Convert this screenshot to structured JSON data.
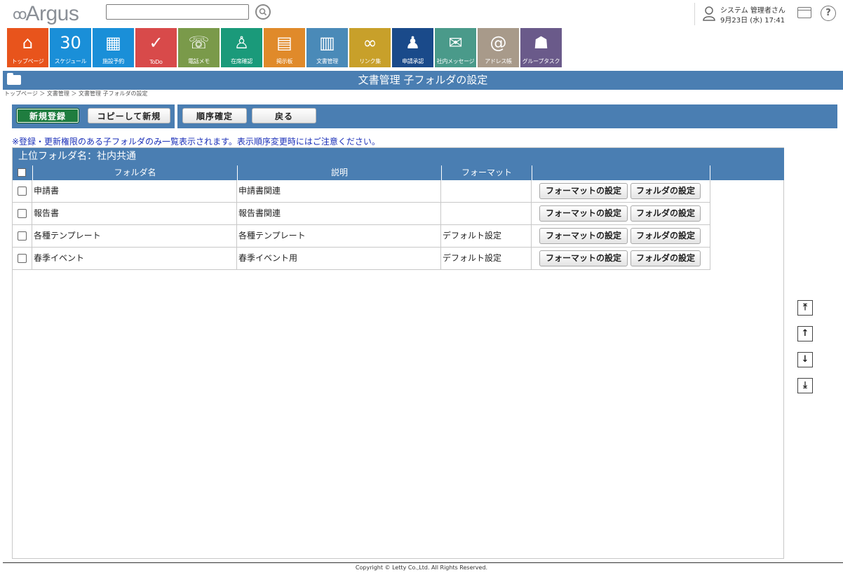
{
  "header": {
    "logo_text": "Argus",
    "search_placeholder": "",
    "user_name": "システム 管理者さん",
    "datetime": "9月23日 (水) 17:41"
  },
  "apps": [
    {
      "label": "トップページ",
      "icon": "house-icon",
      "color": "#e8541c",
      "glyph": "⌂"
    },
    {
      "label": "スケジュール",
      "icon": "calendar-icon",
      "color": "#1a8fd8",
      "glyph": "30"
    },
    {
      "label": "施設予約",
      "icon": "facility-icon",
      "color": "#1a8fd8",
      "glyph": "▦"
    },
    {
      "label": "ToDo",
      "icon": "todo-icon",
      "color": "#d84a4a",
      "glyph": "✓"
    },
    {
      "label": "電話メモ",
      "icon": "phone-icon",
      "color": "#7a9a4a",
      "glyph": "☏"
    },
    {
      "label": "在席確認",
      "icon": "presence-icon",
      "color": "#1a9a7a",
      "glyph": "♙"
    },
    {
      "label": "掲示板",
      "icon": "board-icon",
      "color": "#e08a2a",
      "glyph": "▤"
    },
    {
      "label": "文書管理",
      "icon": "document-icon",
      "color": "#4a8ab8",
      "glyph": "▥"
    },
    {
      "label": "リンク集",
      "icon": "link-icon",
      "color": "#c8a02a",
      "glyph": "∞"
    },
    {
      "label": "申請承認",
      "icon": "stamp-icon",
      "color": "#1a4a8a",
      "glyph": "♟"
    },
    {
      "label": "社内メッセージ",
      "icon": "message-icon",
      "color": "#4a9a8a",
      "glyph": "✉"
    },
    {
      "label": "アドレス帳",
      "icon": "address-book-icon",
      "color": "#a89a8a",
      "glyph": "@"
    },
    {
      "label": "グループタスク",
      "icon": "group-task-icon",
      "color": "#6a5a8a",
      "glyph": "☗"
    }
  ],
  "page": {
    "title": "文書管理 子フォルダの設定",
    "breadcrumb": "トップページ ＞ 文書管理 ＞ 文書管理 子フォルダの設定"
  },
  "toolbar": {
    "new_label": "新規登録",
    "copy_new_label": "コピーして新規",
    "order_confirm_label": "順序確定",
    "back_label": "戻る"
  },
  "notice": "※登録・更新権限のある子フォルダのみ一覧表示されます。表示順序変更時にはご注意ください。",
  "table": {
    "parent_folder": "上位フォルダ名：社内共通",
    "columns": [
      "フォルダ名",
      "説明",
      "フォーマット",
      ""
    ],
    "rows": [
      {
        "name": "申請書",
        "description": "申請書関連",
        "format": "",
        "btn_format": "フォーマットの設定",
        "btn_folder": "フォルダの設定"
      },
      {
        "name": "報告書",
        "description": "報告書関連",
        "format": "",
        "btn_format": "フォーマットの設定",
        "btn_folder": "フォルダの設定"
      },
      {
        "name": "各種テンプレート",
        "description": "各種テンプレート",
        "format": "デフォルト設定",
        "btn_format": "フォーマットの設定",
        "btn_folder": "フォルダの設定"
      },
      {
        "name": "春季イベント",
        "description": "春季イベント用",
        "format": "デフォルト設定",
        "btn_format": "フォーマットの設定",
        "btn_folder": "フォルダの設定"
      }
    ]
  },
  "order_buttons": {
    "top": "⤒",
    "up": "↑",
    "down": "↓",
    "bottom": "⤓"
  },
  "footer": {
    "copyright": "Copyright © Letty Co.,Ltd. All Rights Reserved."
  }
}
